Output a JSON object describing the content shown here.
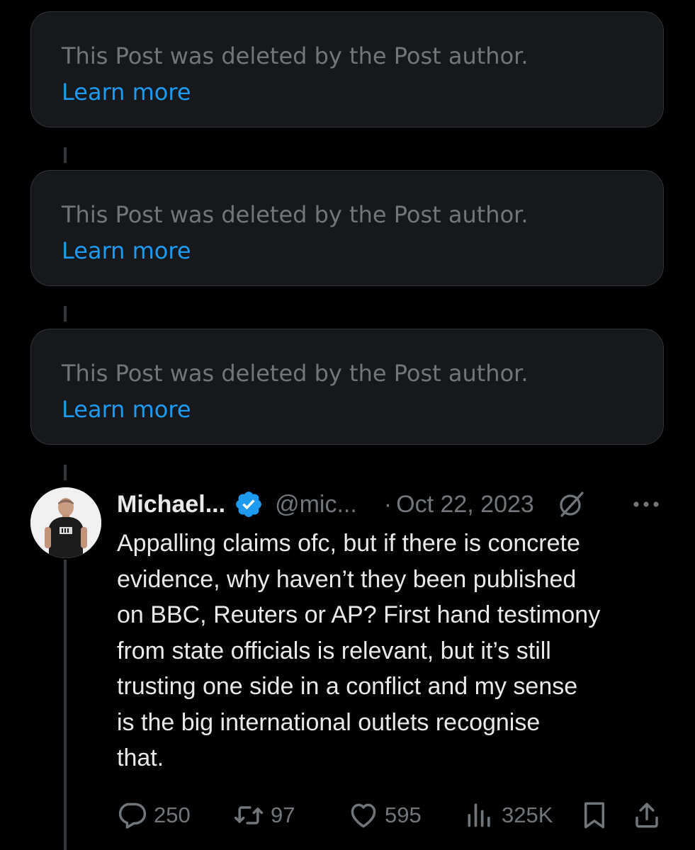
{
  "deleted_posts": [
    {
      "text": "This Post was deleted by the Post author.",
      "link": "Learn more"
    },
    {
      "text": "This Post was deleted by the Post author.",
      "link": "Learn more"
    },
    {
      "text": "This Post was deleted by the Post author.",
      "link": "Learn more"
    }
  ],
  "tweet": {
    "author_name": "Michael...",
    "handle": "@mic...",
    "separator": "·",
    "date": "Oct 22, 2023",
    "body": "Appalling claims ofc, but if there is concrete\nevidence, why haven’t they been published\non BBC, Reuters or AP? First hand testimony\nfrom state officials is relevant, but it’s still\ntrusting one side in a conflict and my sense\nis the big international outlets recognise\nthat.",
    "actions": {
      "replies": "250",
      "reposts": "97",
      "likes": "595",
      "views": "325K"
    }
  },
  "icons": {
    "verified": "verified-badge-icon",
    "grok": "grok-icon",
    "more": "more-options-icon",
    "reply": "reply-icon",
    "repost": "repost-icon",
    "like": "like-icon",
    "views": "views-icon",
    "bookmark": "bookmark-icon",
    "share": "share-icon"
  },
  "colors": {
    "background": "#000000",
    "card": "#16181c",
    "muted_text": "#71767b",
    "link": "#1d9bf0",
    "text": "#e7e9ea",
    "verified": "#1d9bf0"
  }
}
